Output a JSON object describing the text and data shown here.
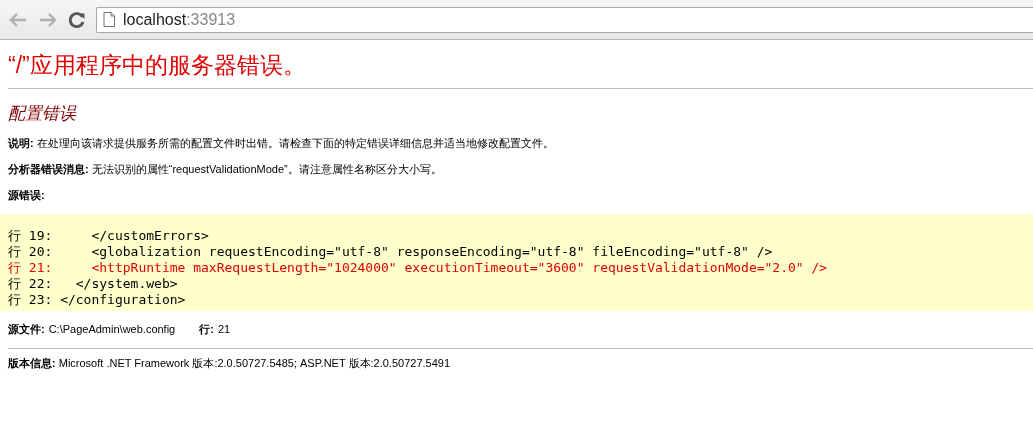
{
  "browser": {
    "url_host": "localhost",
    "url_port": ":33913"
  },
  "title": "“/”应用程序中的服务器错误。",
  "subtitle": "配置错误",
  "paragraphs": [
    "**说明:** 在处理向该请求提供服务所需的配置文件时出错。请检查下面的特定错误详细信息并适当地修改配置文件。",
    "**分析器错误消息:** 无法识别的属性“requestValidationMode”。请注意属性名称区分大小写。",
    "**源错误:**"
  ],
  "code_lines": [
    {
      "text": "行 19:     </customErrors>",
      "highlighted": false
    },
    {
      "text": "行 20:     <globalization requestEncoding=\"utf-8\" responseEncoding=\"utf-8\" fileEncoding=\"utf-8\" />",
      "highlighted": false
    },
    {
      "text": "行 21:     <httpRuntime maxRequestLength=\"1024000\" executionTimeout=\"3600\" requestValidationMode=\"2.0\" />",
      "highlighted": true
    },
    {
      "text": "行 22:   </system.web>",
      "highlighted": false
    },
    {
      "text": "行 23: </configuration>",
      "highlighted": false
    }
  ],
  "source_file": {
    "label": "源文件:",
    "value": "C:\\PageAdmin\\web.config"
  },
  "source_line": {
    "label": "行:",
    "value": "21"
  },
  "version": "**版本信息:** Microsoft .NET Framework 版本:2.0.50727.5485; ASP.NET 版本:2.0.50727.5491"
}
